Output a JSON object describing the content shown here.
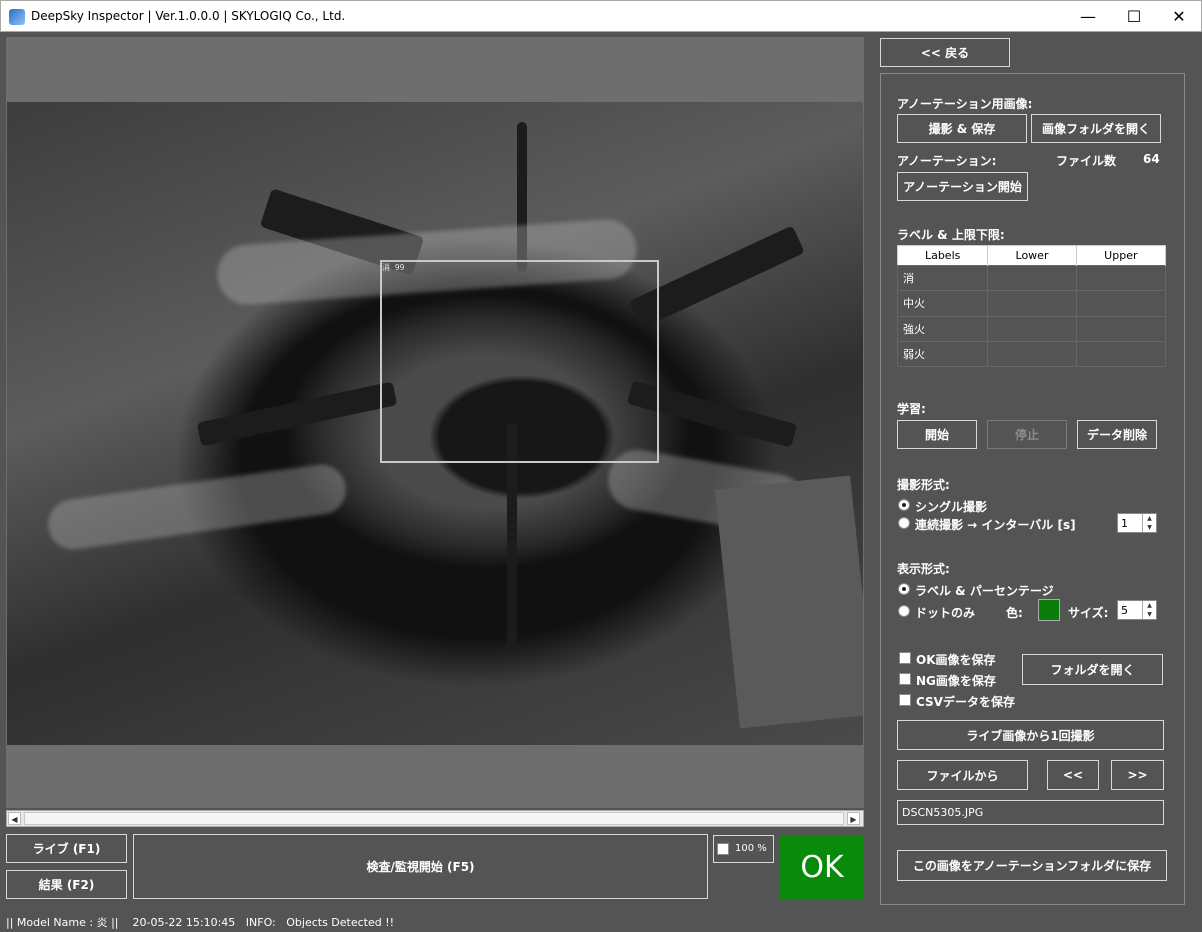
{
  "window": {
    "title": "DeepSky Inspector | Ver.1.0.0.0 | SKYLOGIQ Co., Ltd.",
    "minimize": "—",
    "maximize": "☐",
    "close": "✕"
  },
  "viewer": {
    "detection_label": "消 99",
    "scroll_left": "◀",
    "scroll_right": "▶"
  },
  "bottom": {
    "live_button": "ライブ (F1)",
    "result_button": "結果 (F2)",
    "inspect_button": "検査/監視開始 (F5)",
    "zoom_value": "100 %",
    "result_text": "OK"
  },
  "panel": {
    "back_button": "<< 戻る",
    "annotation_images_label": "アノーテーション用画像:",
    "capture_save_button": "撮影 & 保存",
    "open_image_folder_button": "画像フォルダを開く",
    "annotation_label": "アノーテーション:",
    "file_count_label": "ファイル数",
    "file_count_value": "64",
    "start_annotation_button": "アノーテーション開始",
    "labels_section_label": "ラベル & 上限下限:",
    "table": {
      "headers": [
        "Labels",
        "Lower",
        "Upper"
      ],
      "rows": [
        [
          "消",
          "",
          ""
        ],
        [
          "中火",
          "",
          ""
        ],
        [
          "強火",
          "",
          ""
        ],
        [
          "弱火",
          "",
          ""
        ]
      ]
    },
    "learning_label": "学習:",
    "learn_start_button": "開始",
    "learn_stop_button": "停止",
    "delete_data_button": "データ削除",
    "capture_mode_label": "撮影形式:",
    "single_capture": "シングル撮影",
    "continuous_capture": "連続撮影 → インターバル [s]",
    "interval_value": "1",
    "display_mode_label": "表示形式:",
    "label_percentage": "ラベル & パーセンテージ",
    "dot_only": "ドットのみ",
    "color_label": "色:",
    "size_label": "サイズ:",
    "size_value": "5",
    "save_ok_images": "OK画像を保存",
    "save_ng_images": "NG画像を保存",
    "save_csv": "CSVデータを保存",
    "open_folder_button": "フォルダを開く",
    "capture_once_button": "ライブ画像から1回撮影",
    "from_file_button": "ファイルから",
    "prev_button": "<<",
    "next_button": ">>",
    "filename": "DSCN5305.JPG",
    "save_to_annotation_button": "この画像をアノーテーションフォルダに保存"
  },
  "status": {
    "text": "|| Model Name : 炎 ||    20-05-22 15:10:45   INFO:   Objects Detected !!"
  },
  "colors": {
    "background": "#545454",
    "ok_green": "#0a8a0a",
    "dot_color": "#0a7d0a"
  }
}
